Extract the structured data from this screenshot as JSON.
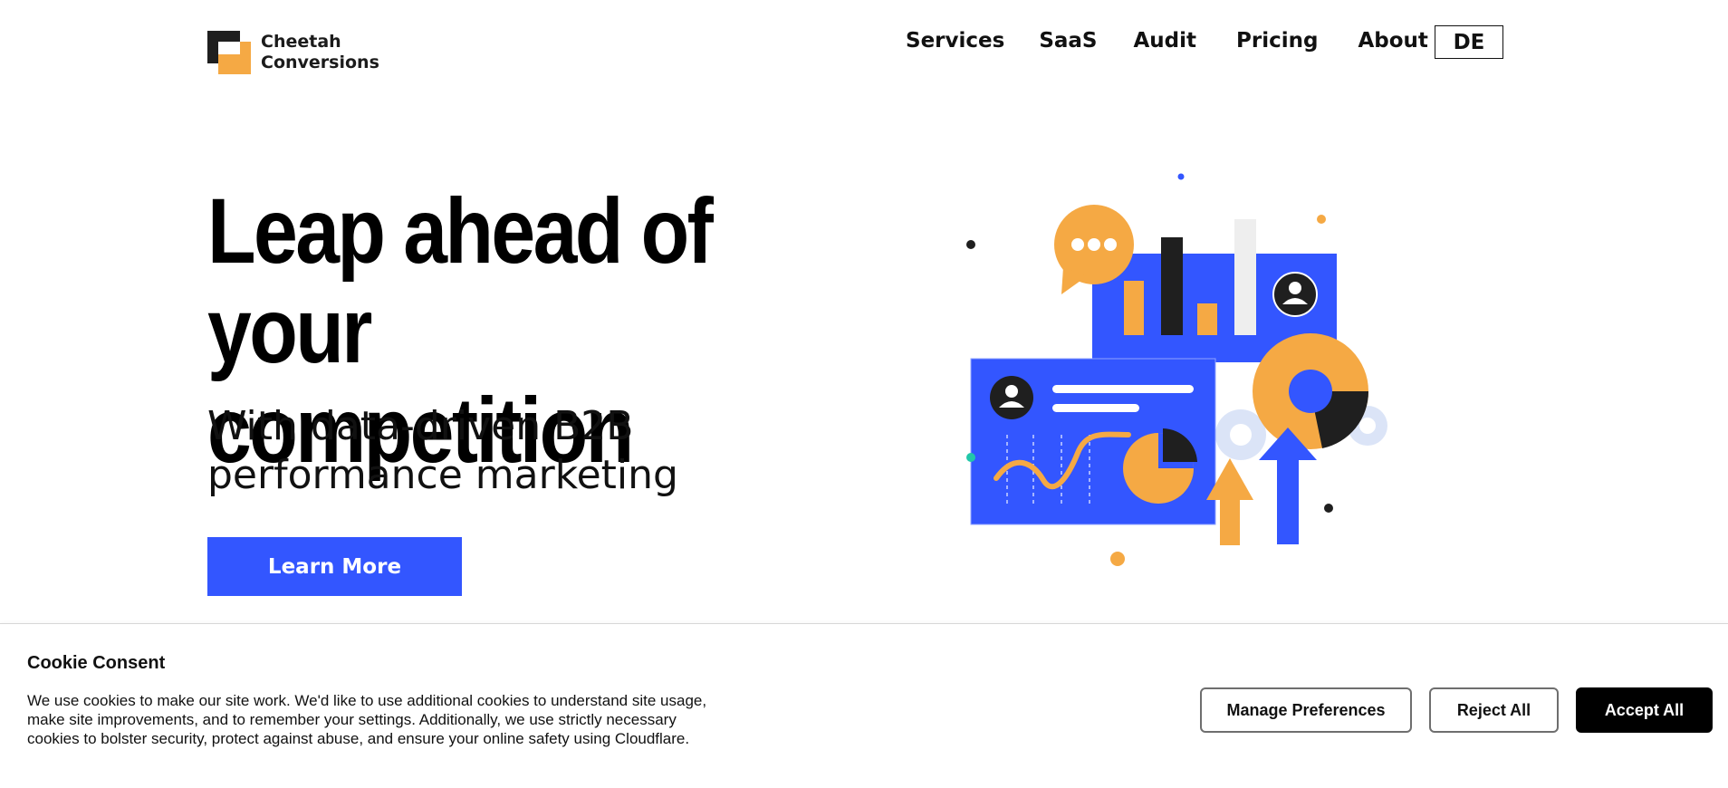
{
  "brand": {
    "name_line1": "Cheetah",
    "name_line2": "Conversions"
  },
  "nav": {
    "items": [
      {
        "label": "Services"
      },
      {
        "label": "SaaS"
      },
      {
        "label": "Audit"
      },
      {
        "label": "Pricing"
      },
      {
        "label": "About us"
      }
    ],
    "language_label": "DE"
  },
  "hero": {
    "title_line1": "Leap ahead of",
    "title_line2": "your competition",
    "subtitle_line1": "With data-driven B2B",
    "subtitle_line2": "performance marketing",
    "cta_label": "Learn More"
  },
  "cookie_banner": {
    "title": "Cookie Consent",
    "text": "We use cookies to make our site work. We'd like to use additional cookies to understand site usage, make site improvements, and to remember your settings. Additionally, we use strictly necessary cookies to bolster security, protect against abuse, and ensure your online safety using Cloudflare.",
    "manage_label": "Manage Preferences",
    "reject_label": "Reject All",
    "accept_label": "Accept All"
  },
  "colors": {
    "accent_blue": "#3356ff",
    "brand_orange": "#f5a944",
    "dark": "#1f1f1f"
  }
}
